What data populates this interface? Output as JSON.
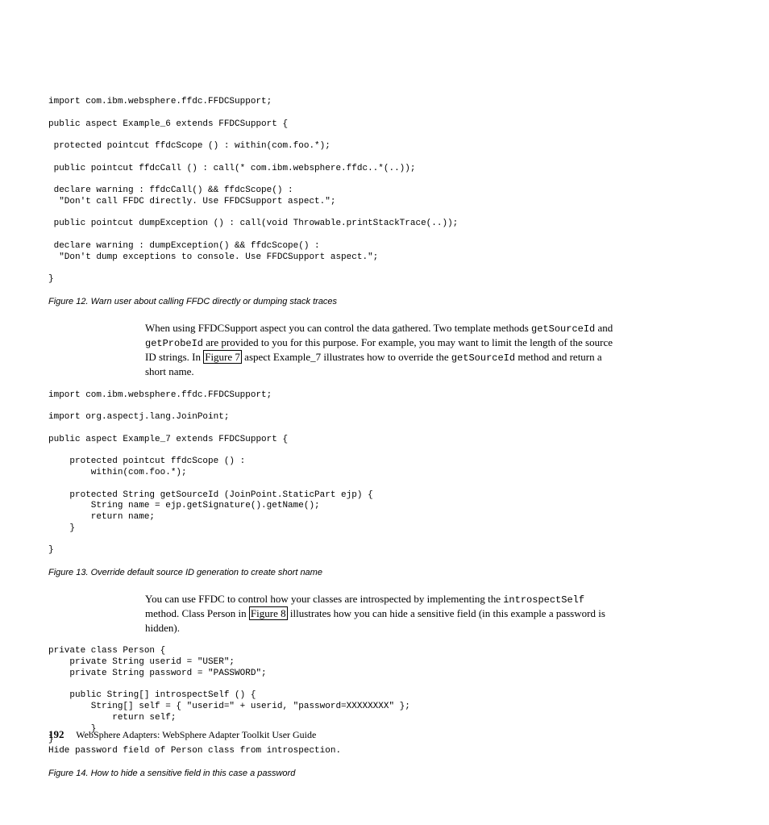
{
  "code1": "import com.ibm.websphere.ffdc.FFDCSupport;\n\npublic aspect Example_6 extends FFDCSupport {\n\n protected pointcut ffdcScope () : within(com.foo.*);\n\n public pointcut ffdcCall () : call(* com.ibm.websphere.ffdc..*(..));\n\n declare warning : ffdcCall() && ffdcScope() :\n  \"Don't call FFDC directly. Use FFDCSupport aspect.\";\n\n public pointcut dumpException () : call(void Throwable.printStackTrace(..));\n\n declare warning : dumpException() && ffdcScope() :\n  \"Don't dump exceptions to console. Use FFDCSupport aspect.\";\n\n}",
  "caption1": "Figure 12. Warn user about calling FFDC directly or dumping stack traces",
  "para1_a": "When using FFDCSupport aspect you can control the data gathered. Two template methods ",
  "para1_m1": "getSourceId",
  "para1_b": " and ",
  "para1_m2": "getProbeId",
  "para1_c": " are provided to you for this purpose. For example, you may want to limit the length of the source ID strings. In ",
  "para1_link": "Figure 7",
  "para1_d": " aspect Example_7 illustrates how to override the ",
  "para1_m3": "getSourceId",
  "para1_e": " method and return a short name.",
  "code2": "import com.ibm.websphere.ffdc.FFDCSupport;\n\nimport org.aspectj.lang.JoinPoint;\n\npublic aspect Example_7 extends FFDCSupport {\n\n    protected pointcut ffdcScope () :\n        within(com.foo.*);\n\n    protected String getSourceId (JoinPoint.StaticPart ejp) {\n        String name = ejp.getSignature().getName();\n        return name;\n    }\n\n}",
  "caption2": "Figure 13. Override default source ID generation to create short name",
  "para2_a": "You can use FFDC to control how your classes are introspected by implementing the ",
  "para2_m1": "introspectSelf",
  "para2_b": " method. Class Person in ",
  "para2_link": "Figure 8",
  "para2_c": " illustrates how you can hide a sensitive field (in this example a password is hidden).",
  "code3": "private class Person {\n    private String userid = \"USER\";\n    private String password = \"PASSWORD\";\n\n    public String[] introspectSelf () {\n        String[] self = { \"userid=\" + userid, \"password=XXXXXXXX\" };\n            return self;\n        }\n}\nHide password field of Person class from introspection.",
  "caption3": "Figure 14. How to hide a sensitive field in this case a password",
  "footer_page": "192",
  "footer_text": "WebSphere Adapters: WebSphere Adapter Toolkit User Guide"
}
